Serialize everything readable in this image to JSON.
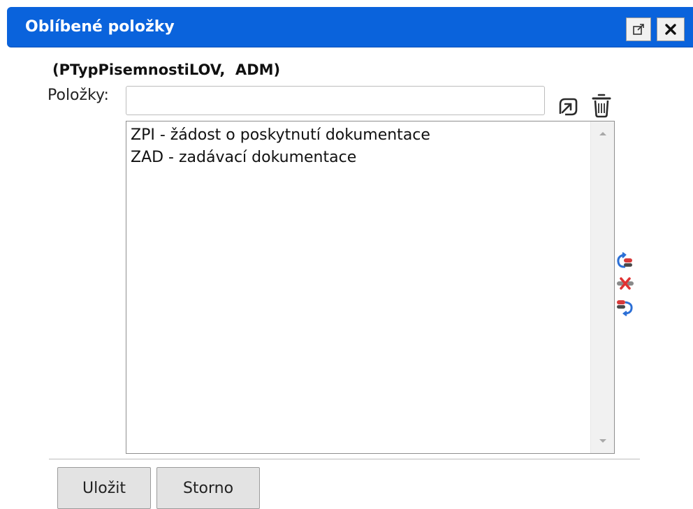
{
  "dialog": {
    "title": "Oblíbené položky",
    "popout_icon": "popout-icon",
    "close_icon": "close-icon",
    "accent_color": "#0a63dc"
  },
  "subtitle": "(PTypPisemnostiLOV,  ADM)",
  "items_field": {
    "label": "Položky:",
    "value": "",
    "placeholder": ""
  },
  "toolbar": {
    "add_icon": "add-arrow-icon",
    "delete_icon": "trash-icon"
  },
  "list": {
    "items": [
      "ZPI - žádost o poskytnutí dokumentace",
      "ZAD - zadávací dokumentace"
    ]
  },
  "side_actions": [
    {
      "icon": "refresh-icon"
    },
    {
      "icon": "remove-icon"
    },
    {
      "icon": "redo-icon"
    }
  ],
  "buttons": {
    "save_label": "Uložit",
    "cancel_label": "Storno"
  }
}
